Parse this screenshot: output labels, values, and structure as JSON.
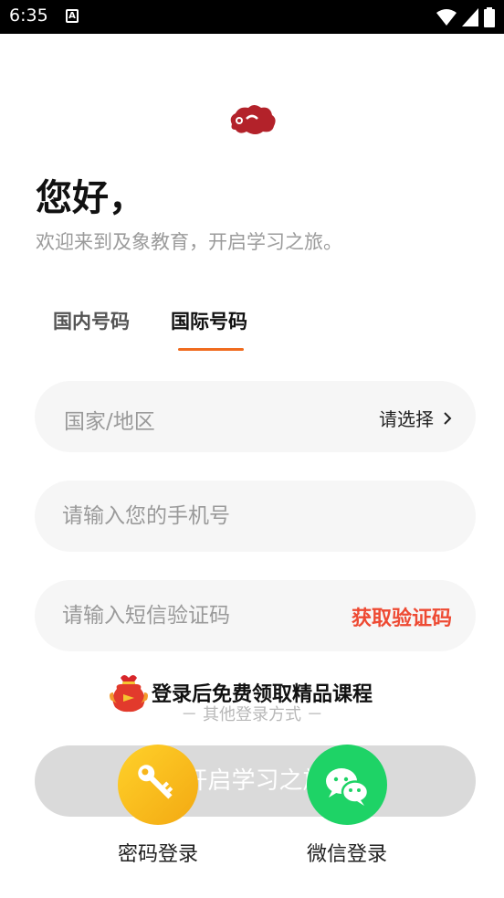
{
  "status_bar": {
    "time": "6:35"
  },
  "greeting": {
    "title": "您好，",
    "subtitle": "欢迎来到及象教育，开启学习之旅。"
  },
  "tabs": [
    {
      "label": "国内号码",
      "active": false
    },
    {
      "label": "国际号码",
      "active": true
    }
  ],
  "form": {
    "country_placeholder": "国家/地区",
    "country_choose": "请选择",
    "phone_placeholder": "请输入您的手机号",
    "code_placeholder": "请输入短信验证码",
    "get_code_label": "获取验证码",
    "submit_label": "开启学习之旅"
  },
  "promo": {
    "text": "登录后免费领取精品课程"
  },
  "other_login": {
    "label": "－ 其他登录方式 －"
  },
  "social": [
    {
      "label": "密码登录",
      "icon": "key-icon"
    },
    {
      "label": "微信登录",
      "icon": "wechat-icon"
    }
  ],
  "colors": {
    "accent": "#f06b1e",
    "get_code": "#ee4a33",
    "wechat": "#1ed366",
    "password": "#f7b51a",
    "logo": "#b3222a"
  }
}
